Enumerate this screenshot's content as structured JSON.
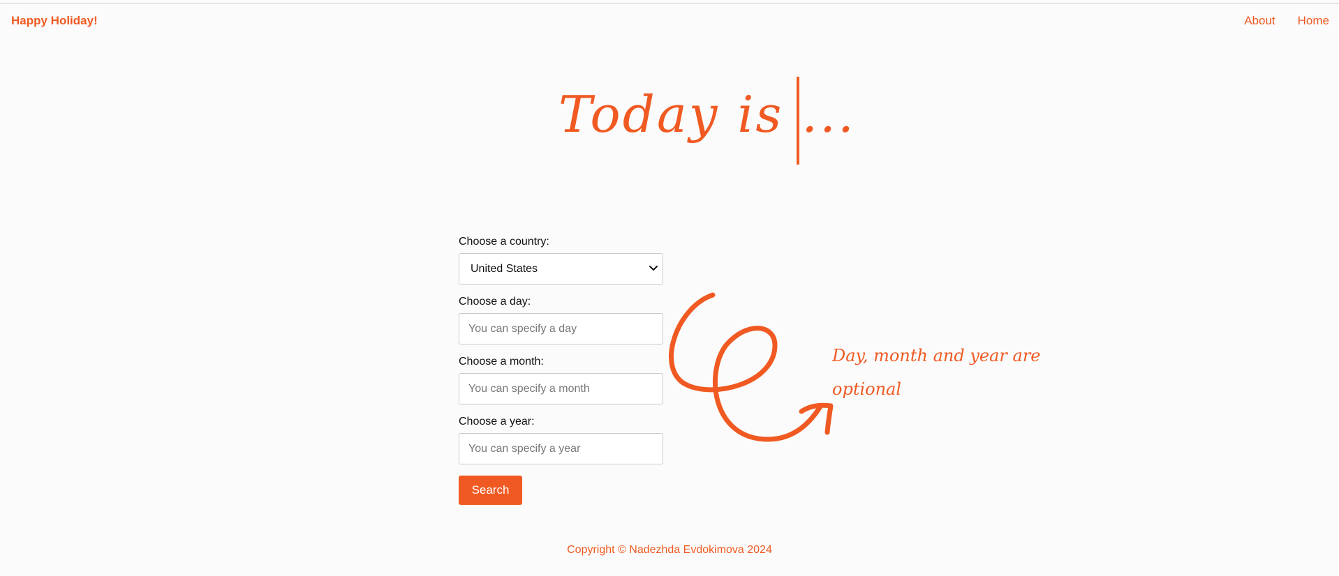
{
  "header": {
    "brand": "Happy Holiday!",
    "nav": [
      {
        "label": "About"
      },
      {
        "label": "Home"
      }
    ]
  },
  "hero": {
    "title": "Today is ..."
  },
  "form": {
    "country": {
      "label": "Choose a country:",
      "selected": "United States"
    },
    "day": {
      "label": "Choose a day:",
      "placeholder": "You can specify a day"
    },
    "month": {
      "label": "Choose a month:",
      "placeholder": "You can specify a month"
    },
    "year": {
      "label": "Choose a year:",
      "placeholder": "You can specify a year"
    },
    "search_label": "Search"
  },
  "annotation": {
    "note": "Day, month and year are optional",
    "icon": "curly-arrow-icon"
  },
  "footer": {
    "copyright": "Copyright © Nadezhda Evdokimova 2024"
  },
  "colors": {
    "accent": "#f05a22",
    "background": "#fbfbfb"
  }
}
